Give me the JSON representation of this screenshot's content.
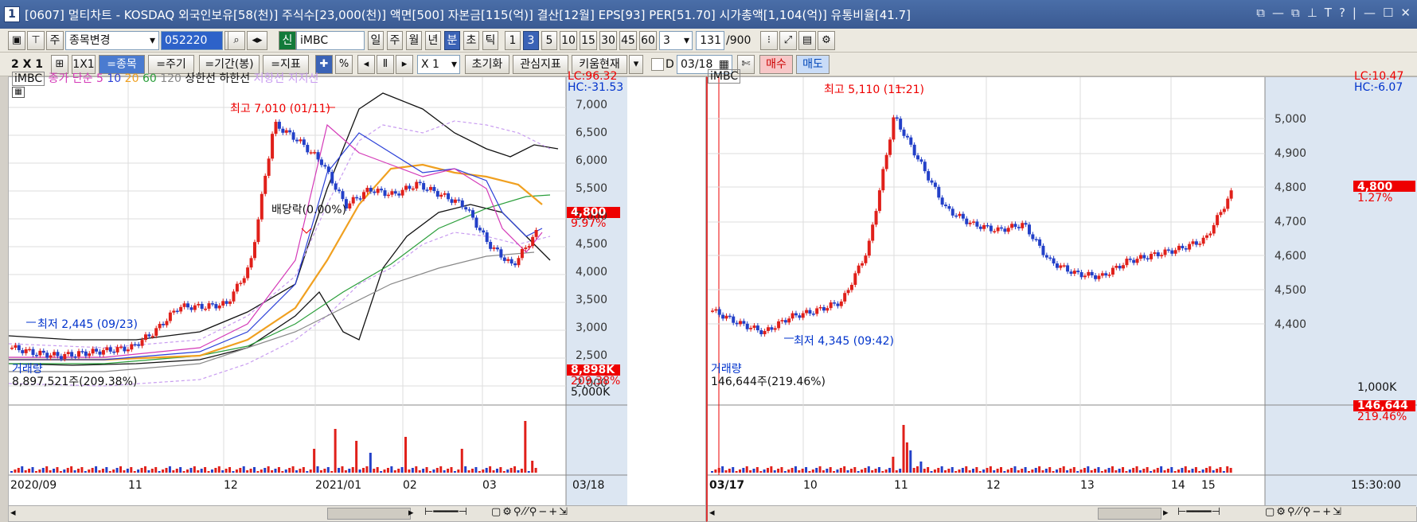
{
  "title": {
    "num": "1",
    "text": "[0607] 멀티차트 - KOSDAQ 외국인보유[58(천)] 주식수[23,000(천)] 액면[500] 자본금[115(억)] 결산[12월] EPS[93] PER[51.70] 시가총액[1,104(억)] 유통비율[41.7]"
  },
  "toolbar1": {
    "period_sel": "주",
    "change_label": "종목변경",
    "code": "052220",
    "tag": "신",
    "name": "iMBC",
    "periods": [
      "일",
      "주",
      "월",
      "년",
      "분",
      "초",
      "틱"
    ],
    "intervals": [
      "1",
      "3",
      "5",
      "10",
      "15",
      "30",
      "45",
      "60"
    ],
    "interval_value": "3",
    "count": "131",
    "count_max": "/900"
  },
  "toolbar2": {
    "layout": "2 X 1",
    "one": "1X1",
    "jongmok": "=종목",
    "jugi": "=주기",
    "gigan": "=기간(봉)",
    "jipyo": "=지표",
    "percent": "%",
    "zoom": "X 1",
    "reset": "초기화",
    "interest": "관심지표",
    "kiwoom": "키움현재",
    "d_label": "D",
    "date": "03/18",
    "buy": "매수",
    "sell": "매도"
  },
  "left": {
    "legend": {
      "name": "iMBC",
      "ma_title": "종가 단순",
      "ma": [
        "5",
        "10",
        "20",
        "60",
        "120"
      ],
      "upper": "상한선",
      "lower": "하한선",
      "resist": "저항선",
      "support": "지지선"
    },
    "lc": "LC:96.32",
    "hc": "HC:-31.53",
    "max_label": "최고 7,010 (01/11)",
    "min_label": "최저 2,445 (09/23)",
    "dividend": "배당락(0.00%)",
    "price_ticks": [
      "7,000",
      "6,500",
      "6,000",
      "5,500",
      "5,000",
      "4,500",
      "4,000",
      "3,500",
      "3,000",
      "2,500",
      "2,000"
    ],
    "last_price": "4,800",
    "last_pct": "9.97%",
    "vol_title": "거래량",
    "vol_value": "8,897,521주(209.38%)",
    "vol_tag": "8,898K",
    "vol_pct": "209.38%",
    "vol_tick": "5,000K",
    "x_ticks": [
      "2020/09",
      "11",
      "12",
      "2021/01",
      "02",
      "03"
    ],
    "x_end": "03/18"
  },
  "right": {
    "name": "iMBC",
    "lc": "LC:10.47",
    "hc": "HC:-6.07",
    "max_label": "최고 5,110 (11:21)",
    "min_label": "최저 4,345 (09:42)",
    "price_ticks": [
      "5,000",
      "4,900",
      "4,800",
      "4,700",
      "4,600",
      "4,500",
      "4,400"
    ],
    "last_price": "4,800",
    "last_pct": "1.27%",
    "vol_title": "거래량",
    "vol_value": "146,644주(219.46%)",
    "vol_tag": "146,644",
    "vol_pct": "219.46%",
    "vol_tick": "1,000K",
    "x_start": "03/17",
    "x_ticks": [
      "10",
      "11",
      "12",
      "13",
      "14",
      "15"
    ],
    "x_end": "15:30:00"
  },
  "chart_data": [
    {
      "type": "candlestick",
      "title": "",
      "series": [
        {
          "name": "iMBC",
          "values": [
            2700,
            2600,
            2550,
            2600,
            2650,
            2700,
            3000,
            3450,
            3450,
            3500,
            4200,
            6800,
            6500,
            6100,
            5300,
            5600,
            5500,
            5700,
            5500,
            5300,
            4600,
            4200,
            4800
          ]
        }
      ],
      "x": [
        "2020/09",
        "",
        "",
        "11",
        "",
        "12",
        "",
        "",
        "2021/01",
        "",
        "",
        "",
        "02",
        "",
        "",
        "03",
        "",
        "",
        "",
        "",
        "",
        "",
        "03/18"
      ],
      "ylim": [
        2000,
        7000
      ]
    },
    {
      "type": "candlestick",
      "title": "",
      "series": [
        {
          "name": "iMBC",
          "values": [
            4420,
            4380,
            4350,
            4400,
            4420,
            4450,
            4620,
            5050,
            4900,
            4750,
            4700,
            4680,
            4700,
            4580,
            4540,
            4530,
            4580,
            4600,
            4620,
            4650,
            4800
          ]
        }
      ],
      "x": [
        "03/17",
        "",
        "10",
        "",
        "11",
        "",
        "",
        "12",
        "",
        "",
        "13",
        "",
        "",
        "14",
        "",
        "",
        "15",
        "",
        "",
        "",
        ""
      ],
      "ylim": [
        4350,
        5100
      ]
    }
  ]
}
